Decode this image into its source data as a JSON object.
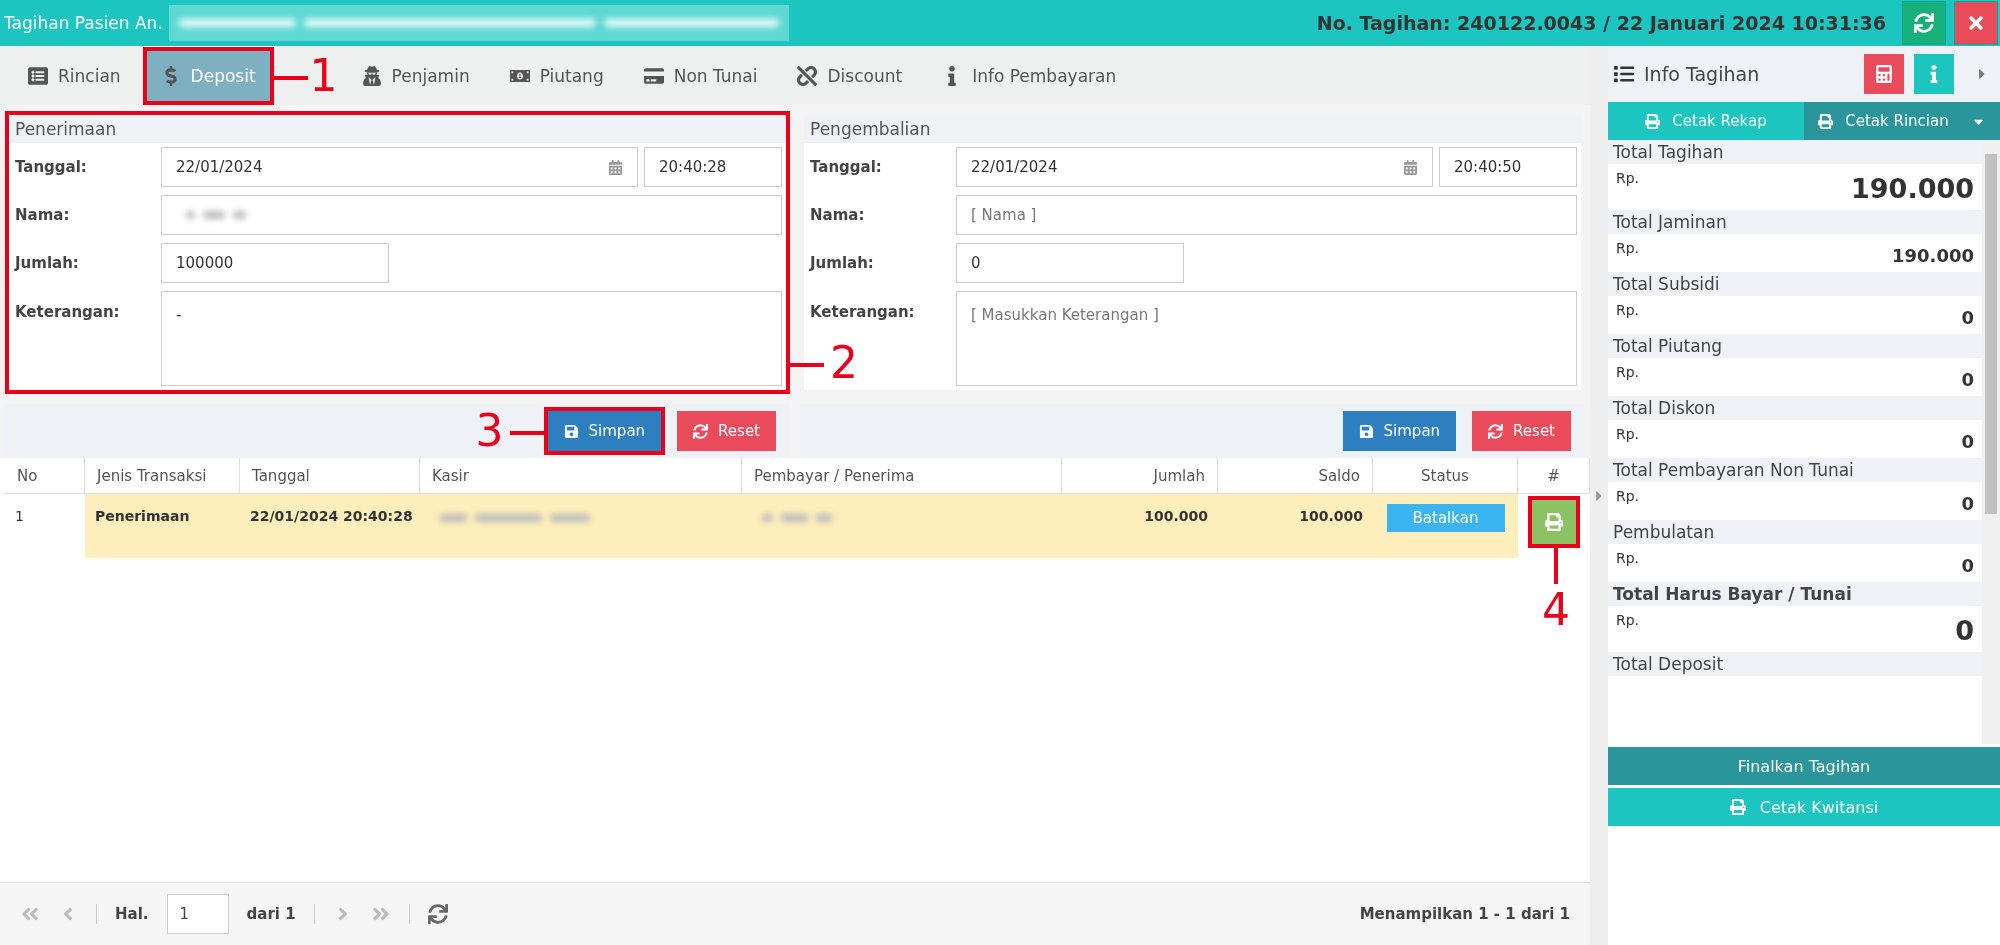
{
  "title_bar": {
    "title": "Tagihan Pasien An.",
    "invoice": "No. Tagihan: 240122.0043 / 22 Januari 2024 10:31:36"
  },
  "tabs": [
    {
      "label": "Rincian",
      "selected": false
    },
    {
      "label": "Deposit",
      "selected": true,
      "callout": "1"
    },
    {
      "label": "Penjamin",
      "selected": false
    },
    {
      "label": "Piutang",
      "selected": false
    },
    {
      "label": "Non Tunai",
      "selected": false
    },
    {
      "label": "Discount",
      "selected": false
    },
    {
      "label": "Info Pembayaran",
      "selected": false
    }
  ],
  "forms": [
    {
      "title": "Penerimaan",
      "callout": "2",
      "fields": [
        {
          "label": "Tanggal:",
          "kind": "datetime",
          "value": "22/01/2024",
          "time": "20:40:28"
        },
        {
          "label": "Nama:",
          "kind": "blurred"
        },
        {
          "label": "Jumlah:",
          "kind": "short",
          "value": "100000"
        },
        {
          "label": "Keterangan:",
          "kind": "area",
          "value": "-"
        }
      ],
      "buttons": [
        {
          "label": "Simpan",
          "kind": "save",
          "callout": "3"
        },
        {
          "label": "Reset",
          "kind": "reset"
        }
      ]
    },
    {
      "title": "Pengembalian",
      "fields": [
        {
          "label": "Tanggal:",
          "kind": "datetime",
          "value": "22/01/2024",
          "time": "20:40:50"
        },
        {
          "label": "Nama:",
          "kind": "text",
          "placeholder": "[ Nama ]"
        },
        {
          "label": "Jumlah:",
          "kind": "short",
          "value": "0"
        },
        {
          "label": "Keterangan:",
          "kind": "area",
          "placeholder": "[ Masukkan Keterangan ]"
        }
      ],
      "buttons": [
        {
          "label": "Simpan",
          "kind": "save"
        },
        {
          "label": "Reset",
          "kind": "reset"
        }
      ]
    }
  ],
  "table": {
    "columns": [
      "No",
      "Jenis Transaksi",
      "Tanggal",
      "Kasir",
      "Pembayar / Penerima",
      "Jumlah",
      "Saldo",
      "Status",
      "#"
    ],
    "rows": [
      {
        "no": "1",
        "type": "Penerimaan",
        "date": "22/01/2024 20:40:28",
        "amount": "100.000",
        "balance": "100.000",
        "status": "Batalkan",
        "print_callout": "4"
      }
    ]
  },
  "pager": {
    "page_label": "Hal.",
    "page": "1",
    "of": "dari 1",
    "summary": "Menampilkan 1 - 1 dari 1"
  },
  "side_panel": {
    "title": "Info Tagihan",
    "print_buttons": [
      "Cetak Rekap",
      "Cetak Rincian"
    ],
    "totals": [
      {
        "label": "Total Tagihan",
        "currency": "Rp.",
        "value": "190.000",
        "large": true,
        "label_bold": false
      },
      {
        "label": "Total Jaminan",
        "currency": "Rp.",
        "value": "190.000",
        "large": false,
        "label_bold": false
      },
      {
        "label": "Total Subsidi",
        "currency": "Rp.",
        "value": "0",
        "large": false,
        "label_bold": false
      },
      {
        "label": "Total Piutang",
        "currency": "Rp.",
        "value": "0",
        "large": false,
        "label_bold": false
      },
      {
        "label": "Total Diskon",
        "currency": "Rp.",
        "value": "0",
        "large": false,
        "label_bold": false
      },
      {
        "label": "Total Pembayaran Non Tunai",
        "currency": "Rp.",
        "value": "0",
        "large": false,
        "label_bold": false
      },
      {
        "label": "Pembulatan",
        "currency": "Rp.",
        "value": "0",
        "large": false,
        "label_bold": false
      },
      {
        "label": "Total Harus Bayar / Tunai",
        "currency": "Rp.",
        "value": "0",
        "large": true,
        "label_bold": true
      },
      {
        "label": "Total Deposit",
        "label_bold": false
      }
    ],
    "finalize": "Finalkan Tagihan",
    "receipt": "Cetak Kwitansi"
  }
}
